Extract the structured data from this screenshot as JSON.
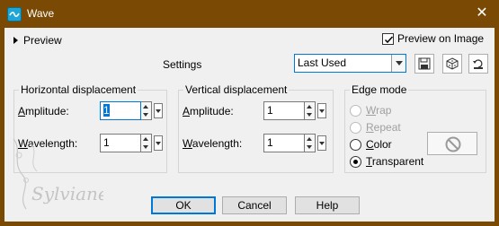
{
  "window": {
    "title": "Wave",
    "close_glyph": "✕",
    "icon": "wave-app-icon"
  },
  "preview": {
    "label": "Preview",
    "preview_on_image_label": "Preview on Image",
    "preview_on_image_checked": true
  },
  "settings": {
    "label": "Settings",
    "selected": "Last Used",
    "icons": [
      "save-preset-icon",
      "randomize-icon",
      "reset-icon"
    ]
  },
  "horizontal": {
    "title": "Horizontal displacement",
    "amplitude_label_u": "A",
    "amplitude_label_rest": "mplitude:",
    "amplitude_value": "1",
    "wavelength_label_u": "W",
    "wavelength_label_rest": "avelength:",
    "wavelength_value": "1"
  },
  "vertical": {
    "title": "Vertical displacement",
    "amplitude_label_u": "A",
    "amplitude_label_rest": "mplitude:",
    "amplitude_value": "1",
    "wavelength_label_u": "W",
    "wavelength_label_rest": "avelength:",
    "wavelength_value": "1"
  },
  "edge_mode": {
    "title": "Edge mode",
    "options": [
      {
        "u": "W",
        "rest": "rap",
        "enabled": false,
        "selected": false
      },
      {
        "u": "R",
        "rest": "epeat",
        "enabled": false,
        "selected": false
      },
      {
        "u": "C",
        "rest": "olor",
        "enabled": true,
        "selected": false
      },
      {
        "u": "T",
        "rest": "ransparent",
        "enabled": true,
        "selected": true
      }
    ],
    "color_swatch_icon": "no-color-icon"
  },
  "buttons": {
    "ok": "OK",
    "cancel": "Cancel",
    "help": "Help"
  },
  "watermark": "Sylviane",
  "colors": {
    "titlebar": "#7a4a05",
    "accent": "#0078d7",
    "dialog_bg": "#f0f0f0"
  }
}
